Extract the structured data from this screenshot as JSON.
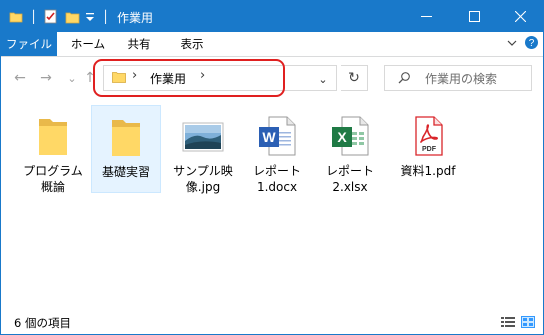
{
  "window": {
    "title": "作業用"
  },
  "titlebar": {
    "quick_access_icons": [
      "folder-icon",
      "properties-check-icon",
      "new-folder-icon",
      "customize-dropdown-icon"
    ],
    "controls": {
      "minimize": "─",
      "maximize": "☐",
      "close": "✕"
    }
  },
  "ribbon": {
    "tabs": [
      {
        "label": "ファイル"
      },
      {
        "label": "ホーム"
      },
      {
        "label": "共有"
      },
      {
        "label": "表示"
      }
    ],
    "expand_icon": "chevron-down-icon",
    "help_icon": "?"
  },
  "navigation": {
    "back": "←",
    "forward": "→",
    "recent": "⌄",
    "up": "↑"
  },
  "address": {
    "sep": "›",
    "crumbs": [
      "作業用"
    ],
    "dropdown": "⌄",
    "refresh": "↻"
  },
  "search": {
    "placeholder": "作業用の検索"
  },
  "items": [
    {
      "name": "プログラム\n概論",
      "type": "folder"
    },
    {
      "name": "基礎実習",
      "type": "folder",
      "selected": true
    },
    {
      "name": "サンプル映\n像.jpg",
      "type": "image"
    },
    {
      "name": "レポート\n1.docx",
      "type": "word"
    },
    {
      "name": "レポート\n2.xlsx",
      "type": "excel"
    },
    {
      "name": "資料1.pdf",
      "type": "pdf"
    }
  ],
  "icon_text": {
    "word": "W",
    "excel": "X",
    "pdf": "PDF"
  },
  "status": {
    "item_count": "6 個の項目"
  },
  "colors": {
    "accent": "#1979ca",
    "folder": "#ffd866",
    "highlight": "#e02020",
    "word": "#2b5fb4",
    "excel": "#1f7a45",
    "pdf": "#d9252a"
  }
}
